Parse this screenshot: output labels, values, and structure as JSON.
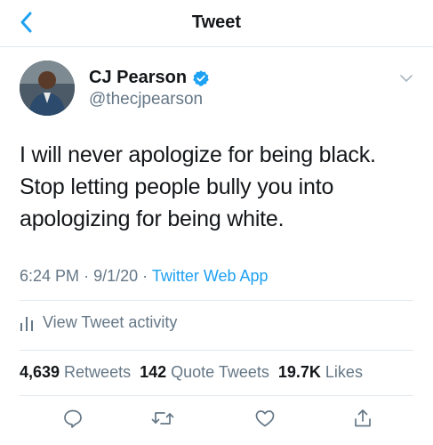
{
  "header": {
    "title": "Tweet",
    "back_icon": "chevron-left-icon"
  },
  "author": {
    "name": "CJ Pearson",
    "handle": "@thecjpearson",
    "verified": true
  },
  "tweet": {
    "text": "I will never apologize for being black. Stop letting people bully you into apologizing for being white.",
    "time": "6:24 PM",
    "date": "9/1/20",
    "separator": "·",
    "source": "Twitter Web App"
  },
  "activity": {
    "label": "View Tweet activity",
    "icon": "bar-chart-icon"
  },
  "stats": {
    "retweets_count": "4,639",
    "retweets_label": "Retweets",
    "quotes_count": "142",
    "quotes_label": "Quote Tweets",
    "likes_count": "19.7K",
    "likes_label": "Likes"
  },
  "actions": [
    "reply-icon",
    "retweet-icon",
    "like-icon",
    "share-icon"
  ],
  "colors": {
    "accent": "#1da1f2",
    "text": "#14171a",
    "secondary": "#657786",
    "divider": "#e1e8ed"
  }
}
